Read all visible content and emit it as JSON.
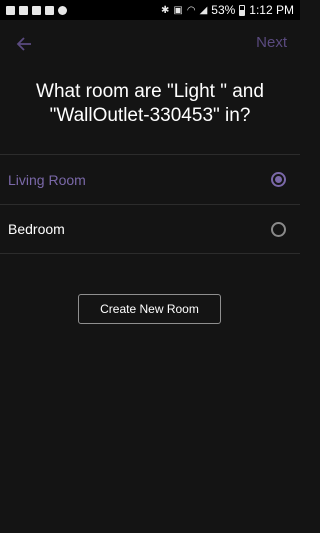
{
  "status_bar": {
    "battery": "53%",
    "time": "1:12 PM",
    "icons": [
      "notification-f-icon",
      "notification-f-icon",
      "notification-f-icon",
      "document-icon",
      "cloud-icon",
      "bluetooth-icon",
      "nfc-icon",
      "wifi-icon",
      "signal-icon",
      "battery-icon"
    ]
  },
  "nav": {
    "back_icon": "arrow-left-icon",
    "next_label": "Next",
    "accent_color": "#7a68a8"
  },
  "question": "What room are \"Light \" and \"WallOutlet-330453\" in?",
  "rooms": [
    {
      "label": "Living Room",
      "selected": true
    },
    {
      "label": "Bedroom",
      "selected": false
    }
  ],
  "create_button": "Create New Room"
}
